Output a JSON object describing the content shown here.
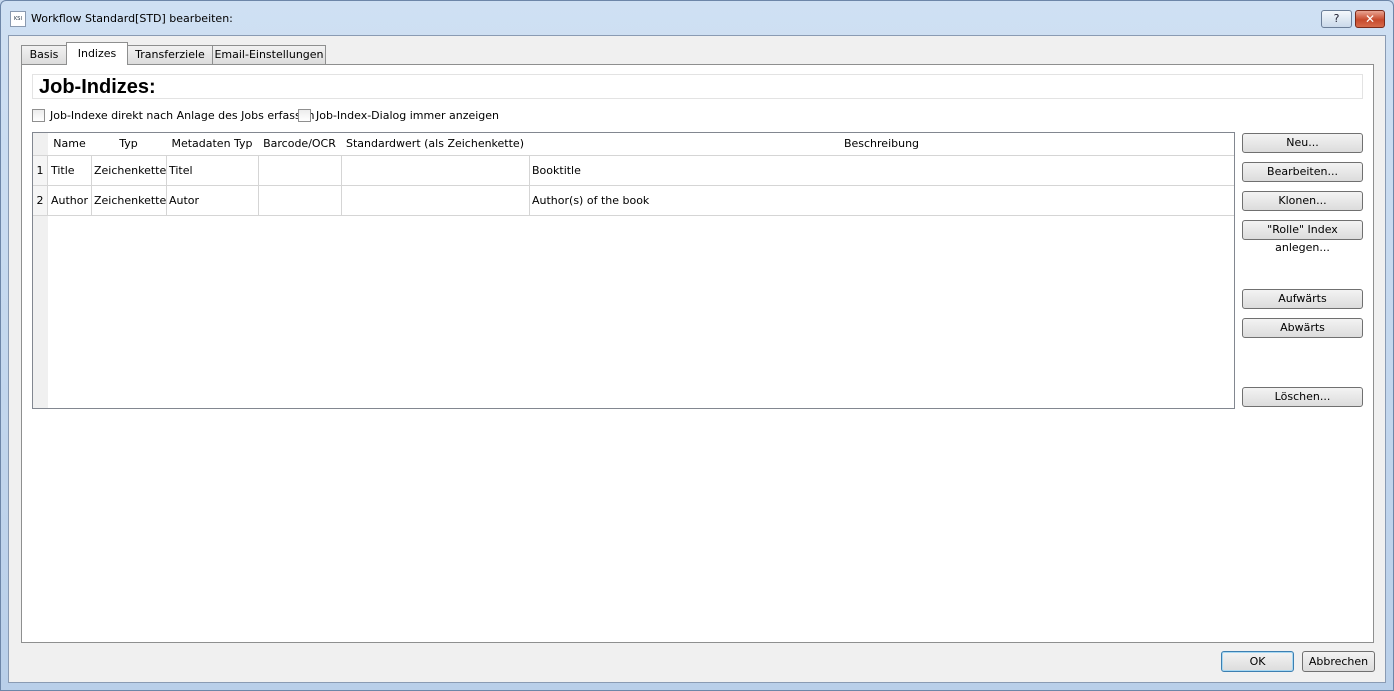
{
  "window": {
    "title": "Workflow Standard[STD] bearbeiten:",
    "icon_text": "KSI",
    "help_label": "?",
    "close_label": "✕"
  },
  "tabs": [
    {
      "label": "Basis"
    },
    {
      "label": "Indizes",
      "active": true
    },
    {
      "label": "Transferziele"
    },
    {
      "label": "Email-Einstellungen"
    }
  ],
  "panel": {
    "title": "Job-Indizes:",
    "checkbox1_label": "Job-Indexe direkt nach Anlage des Jobs erfassen",
    "checkbox2_label": "Job-Index-Dialog immer anzeigen"
  },
  "table": {
    "columns": [
      "Name",
      "Typ",
      "Metadaten Typ",
      "Barcode/OCR",
      "Standardwert (als Zeichenkette)",
      "Beschreibung"
    ],
    "rows": [
      {
        "num": "1",
        "cells": [
          "Title",
          "Zeichenkette",
          "Titel",
          "",
          "",
          "Booktitle"
        ]
      },
      {
        "num": "2",
        "cells": [
          "Author",
          "Zeichenkette",
          "Autor",
          "",
          "",
          "Author(s) of the book"
        ]
      }
    ]
  },
  "side_buttons": {
    "new": "Neu...",
    "edit": "Bearbeiten...",
    "clone": "Klonen...",
    "role_index": "\"Rolle\" Index anlegen...",
    "up": "Aufwärts",
    "down": "Abwärts",
    "delete": "Löschen..."
  },
  "dialog_buttons": {
    "ok": "OK",
    "cancel": "Abbrechen"
  }
}
